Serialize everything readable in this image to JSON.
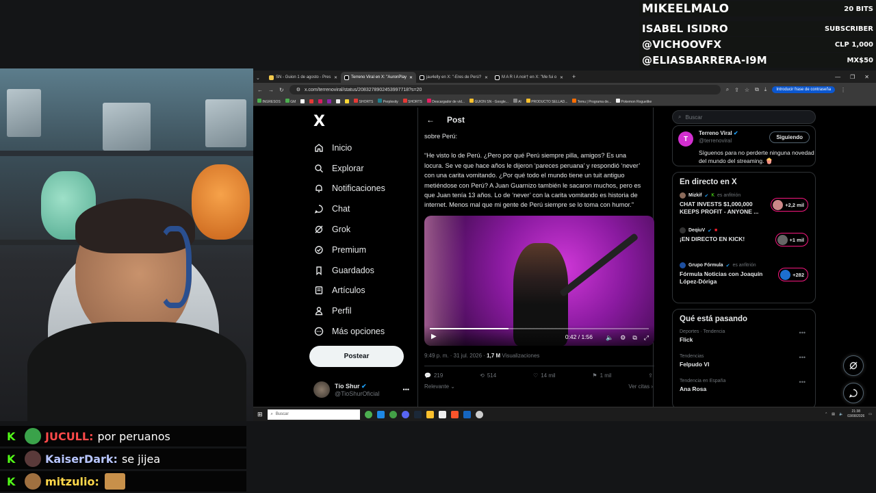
{
  "alerts": [
    {
      "name": "MIKEELMALO",
      "value": "20 BITS"
    },
    {
      "name": "ISABEL ISIDRO",
      "value": "SUBSCRIBER"
    },
    {
      "name": "@VICHOOVFX",
      "value": "CLP 1,000"
    },
    {
      "name": "@ELIASBARRERA-I9M",
      "value": "MX$50"
    }
  ],
  "chat": [
    {
      "badge": "K",
      "user": "JUCULL:",
      "message": "por peruanos",
      "user_color": "#ff4a4a"
    },
    {
      "badge": "K",
      "user": "KaiserDark:",
      "message": "se jijea",
      "user_color": "#b8c6ff"
    },
    {
      "badge": "K",
      "user": "mitzulio:",
      "message": "",
      "user_color": "#ffd84a"
    }
  ],
  "browser": {
    "tabs": [
      {
        "title": "SN - Guion 1 de agosto - Pres"
      },
      {
        "title": "Terreno Viral en X: \"AuronPlay"
      },
      {
        "title": "jau4elly en X: \"-Eres de Perú?"
      },
      {
        "title": "M A R I A noir† en X: \"Me fui o"
      }
    ],
    "url": "x.com/terrenoviral/status/2083278902453997718?s=20",
    "password_prompt": "Introducir frase de contraseña",
    "bookmarks": [
      "INGRESOS",
      "GM",
      "SHORTS",
      "Perplexity",
      "SHORTS",
      "Descargador de víd...",
      "GUION SN - Google...",
      "AI",
      "PRODUCTO SELLAD...",
      "Temu | Programa de...",
      "Pokemon Roguelike"
    ]
  },
  "xnav": {
    "logo": "X",
    "items": [
      {
        "label": "Inicio",
        "icon": "home-icon"
      },
      {
        "label": "Explorar",
        "icon": "search-icon"
      },
      {
        "label": "Notificaciones",
        "icon": "bell-icon"
      },
      {
        "label": "Chat",
        "icon": "chat-icon"
      },
      {
        "label": "Grok",
        "icon": "grok-icon"
      },
      {
        "label": "Premium",
        "icon": "premium-icon"
      },
      {
        "label": "Guardados",
        "icon": "bookmark-icon"
      },
      {
        "label": "Artículos",
        "icon": "article-icon"
      },
      {
        "label": "Perfil",
        "icon": "person-icon"
      },
      {
        "label": "Más opciones",
        "icon": "more-icon"
      }
    ],
    "post_button": "Postear",
    "profile_name": "Tío Shur",
    "profile_handle": "@TioShurOficial"
  },
  "post": {
    "header": "Post",
    "intro": "sobre Perú:",
    "body": "“He visto lo de Perú. ¿Pero por qué Perú siempre pilla, amigos? Es una locura. Se ve que hace años le dijeron ‘pareces peruana’ y respondió ‘never’ con una carita vomitando. ¿Por qué todo el mundo tiene un tuit antiguo metiéndose con Perú? A Juan Guarnizo también le sacaron muchos, pero es que Juan tenía 13 años. Lo de ‘never’ con la carita vomitando es historia de internet. Menos mal que mi gente de Perú siempre se lo toma con humor.”",
    "video_time": "0:42 / 1:56",
    "video_progress": 0.36,
    "date": "9:49 p. m. · 31 jul. 2026 · ",
    "views": "1,7 M",
    "views_label": " Visualizaciones",
    "replies": "219",
    "reposts": "514",
    "likes": "14 mil",
    "bookmarks": "1 mil",
    "sort": "Relevante",
    "quotes": "Ver citas"
  },
  "right": {
    "search_placeholder": "Buscar",
    "follow": {
      "name": "Terreno Viral",
      "handle": "@terrenoviral",
      "button": "Siguiendo",
      "bio": "Síguenos para no perderte ninguna novedad del mundo del streaming. 🍿"
    },
    "live_title": "En directo en X",
    "live": [
      {
        "host": "Mizkif",
        "suffix": "es anfitrión",
        "title": "CHAT INVESTS $1,000,000 KEEPS PROFIT - ANYONE ...",
        "count": "+2,2 mil"
      },
      {
        "host": "DeqiuV",
        "suffix": "",
        "title": "¡EN DIRECTO EN KICK!",
        "count": "+1 mil"
      },
      {
        "host": "Grupo Fórmula",
        "suffix": "es anfitrión",
        "title": "Fórmula Noticias con Joaquín López-Dóriga",
        "count": "+282"
      }
    ],
    "trends_title": "Qué está pasando",
    "trends": [
      {
        "context": "Deportes · Tendencia",
        "name": "Flick"
      },
      {
        "context": "Tendencias",
        "name": "Felpudo VI"
      },
      {
        "context": "Tendencia en España",
        "name": "Ana Rosa"
      }
    ]
  },
  "taskbar": {
    "search": "Buscar",
    "time": "21:38",
    "date": "03/08/2026"
  }
}
